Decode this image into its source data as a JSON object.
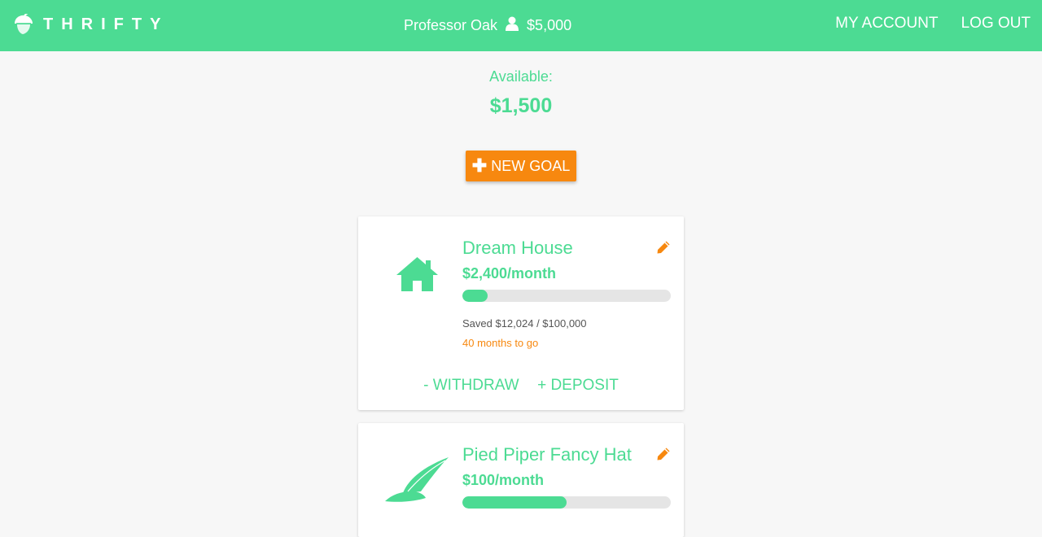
{
  "header": {
    "brand": "THRIFTY",
    "user_name": "Professor Oak",
    "balance": "$5,000",
    "nav": [
      "MY ACCOUNT",
      "LOG OUT"
    ]
  },
  "summary": {
    "available_label": "Available:",
    "available_amount": "$1,500"
  },
  "new_goal_label": "NEW GOAL",
  "goals": [
    {
      "title": "Dream House",
      "rate": "$2,400/month",
      "progress_fraction": 0.12,
      "saved": "Saved $12,024 / $100,000",
      "remaining": "40 months to go",
      "icon": "house-icon",
      "withdraw_label": "- WITHDRAW",
      "deposit_label": "+ DEPOSIT"
    },
    {
      "title": "Pied Piper Fancy Hat",
      "rate": "$100/month",
      "progress_fraction": 0.5,
      "icon": "feather-hat-icon"
    }
  ],
  "colors": {
    "brand_green": "#4cdb93",
    "accent_orange": "#f7880f",
    "background": "#f7f7f7"
  }
}
